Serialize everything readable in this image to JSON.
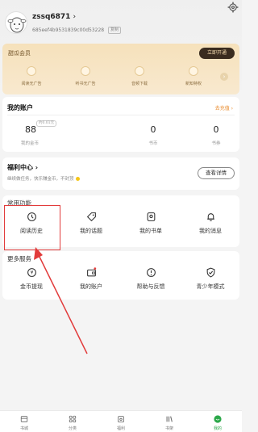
{
  "profile": {
    "username": "zssq6871",
    "user_id": "685eef4b9531839c00d53228",
    "copy_label": "复制"
  },
  "vip": {
    "title": "甜瓜会员",
    "open_button": "立即开通",
    "benefits": [
      {
        "label": "阅读无广告",
        "icon": "book-ad-free-icon"
      },
      {
        "label": "听书无广告",
        "icon": "headphones-icon"
      },
      {
        "label": "音频下载",
        "icon": "microphone-download-icon"
      },
      {
        "label": "新知特权",
        "icon": "gift-icon"
      }
    ]
  },
  "account": {
    "title": "我的账户",
    "recharge_link": "去充值 ›",
    "gold_value": "88",
    "gold_label": "我的金币",
    "expiry_badge": "约0.01元",
    "book_coin_value": "0",
    "book_coin_label": "书币",
    "book_voucher_value": "0",
    "book_voucher_label": "书券"
  },
  "welfare": {
    "title": "福利中心",
    "subtitle": "继续做任务，快乐赚金币，不封顶",
    "detail_button": "查看详情"
  },
  "common_functions": {
    "title": "常用功能",
    "items": [
      {
        "label": "阅读历史",
        "icon": "clock-icon"
      },
      {
        "label": "我的话题",
        "icon": "tag-icon"
      },
      {
        "label": "我的书单",
        "icon": "booklist-icon"
      },
      {
        "label": "我的消息",
        "icon": "bell-icon"
      }
    ]
  },
  "more_services": {
    "title": "更多服务",
    "items": [
      {
        "label": "金币提现",
        "icon": "coin-withdraw-icon"
      },
      {
        "label": "我的账户",
        "icon": "wallet-icon"
      },
      {
        "label": "帮助与反馈",
        "icon": "help-icon"
      },
      {
        "label": "青少年模式",
        "icon": "shield-check-icon"
      }
    ]
  },
  "tabbar": {
    "items": [
      {
        "label": "书城",
        "icon": "bookstore-icon",
        "active": false
      },
      {
        "label": "分类",
        "icon": "category-icon",
        "active": false
      },
      {
        "label": "福利",
        "icon": "welfare-icon",
        "active": false
      },
      {
        "label": "书架",
        "icon": "bookshelf-icon",
        "active": false
      },
      {
        "label": "我的",
        "icon": "profile-icon",
        "active": true
      }
    ]
  },
  "colors": {
    "accent_green": "#2ca84a",
    "recharge_orange": "#e98a2b",
    "vip_gold": "#f6e1bb",
    "annotation_red": "#e23b3b"
  }
}
